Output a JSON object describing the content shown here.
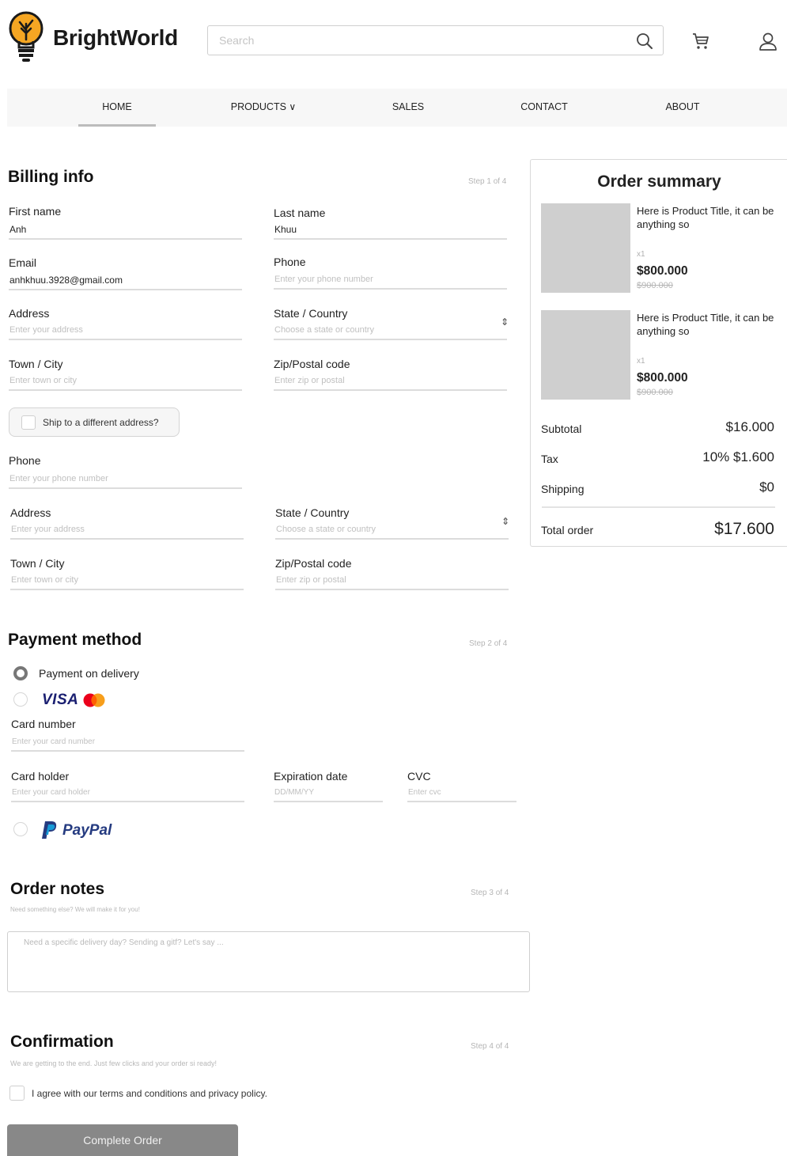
{
  "brand": "BrightWorld",
  "search": {
    "placeholder": "Search"
  },
  "nav": [
    {
      "label": "HOME"
    },
    {
      "label": "PRODUCTS"
    },
    {
      "label": "SALES"
    },
    {
      "label": "CONTACT"
    },
    {
      "label": "ABOUT"
    }
  ],
  "billing": {
    "title": "Billing info",
    "step": "Step 1 of 4",
    "first_name": {
      "label": "First name",
      "value": "Anh"
    },
    "last_name": {
      "label": "Last name",
      "value": "Khuu"
    },
    "email": {
      "label": "Email",
      "value": "anhkhuu.3928@gmail.com"
    },
    "phone": {
      "label": "Phone",
      "placeholder": "Enter your phone number"
    },
    "address": {
      "label": "Address",
      "placeholder": "Enter your address"
    },
    "state": {
      "label": "State / Country",
      "placeholder": "Choose a state or country"
    },
    "town": {
      "label": "Town / City",
      "placeholder": "Enter town or city"
    },
    "zip": {
      "label": "Zip/Postal code",
      "placeholder": "Enter zip or postal"
    },
    "ship_different": "Ship to a different address?"
  },
  "shipping": {
    "phone": {
      "label": "Phone",
      "placeholder": "Enter your phone number"
    },
    "address": {
      "label": "Address",
      "placeholder": "Enter your address"
    },
    "state": {
      "label": "State / Country",
      "placeholder": "Choose a state or country"
    },
    "town": {
      "label": "Town / City",
      "placeholder": "Enter town or city"
    },
    "zip": {
      "label": "Zip/Postal code",
      "placeholder": "Enter zip or postal"
    }
  },
  "payment": {
    "title": "Payment method",
    "step": "Step 2 of 4",
    "on_delivery": "Payment on delivery",
    "visa": "VISA",
    "card_number": {
      "label": "Card number",
      "placeholder": "Enter your card number"
    },
    "card_holder": {
      "label": "Card holder",
      "placeholder": "Enter your card holder"
    },
    "expiration": {
      "label": "Expiration date",
      "placeholder": "DD/MM/YY"
    },
    "cvc": {
      "label": "CVC",
      "placeholder": "Enter cvc"
    },
    "paypal": "PayPal"
  },
  "notes": {
    "title": "Order notes",
    "step": "Step 3 of 4",
    "subtitle": "Need something else? We will make it for you!",
    "placeholder": "Need a specific delivery day? Sending a gitf? Let's say ..."
  },
  "confirmation": {
    "title": "Confirmation",
    "step": "Step 4 of 4",
    "subtitle": "We are getting to the end. Just few clicks and your order si ready!",
    "agree": "I agree with our terms and conditions and privacy policy.",
    "button": "Complete Order"
  },
  "summary": {
    "title": "Order summary",
    "items": [
      {
        "title": "Here is Product Title, it can be anything so",
        "qty": "x1",
        "price": "$800.000",
        "old_price": "$900.000"
      },
      {
        "title": "Here is Product Title, it can be anything so",
        "qty": "x1",
        "price": "$800.000",
        "old_price": "$900.000"
      }
    ],
    "subtotal": {
      "label": "Subtotal",
      "value": "$16.000"
    },
    "tax": {
      "label": "Tax",
      "value": "10% $1.600"
    },
    "shipping": {
      "label": "Shipping",
      "value": "$0"
    },
    "total": {
      "label": "Total order",
      "value": "$17.600"
    }
  },
  "colors": {
    "logo_orange": "#f5a623",
    "button_gray": "#888888",
    "mastercard_red": "#eb001b",
    "mastercard_orange": "#f79e1b",
    "paypal_blue": "#253b80"
  }
}
